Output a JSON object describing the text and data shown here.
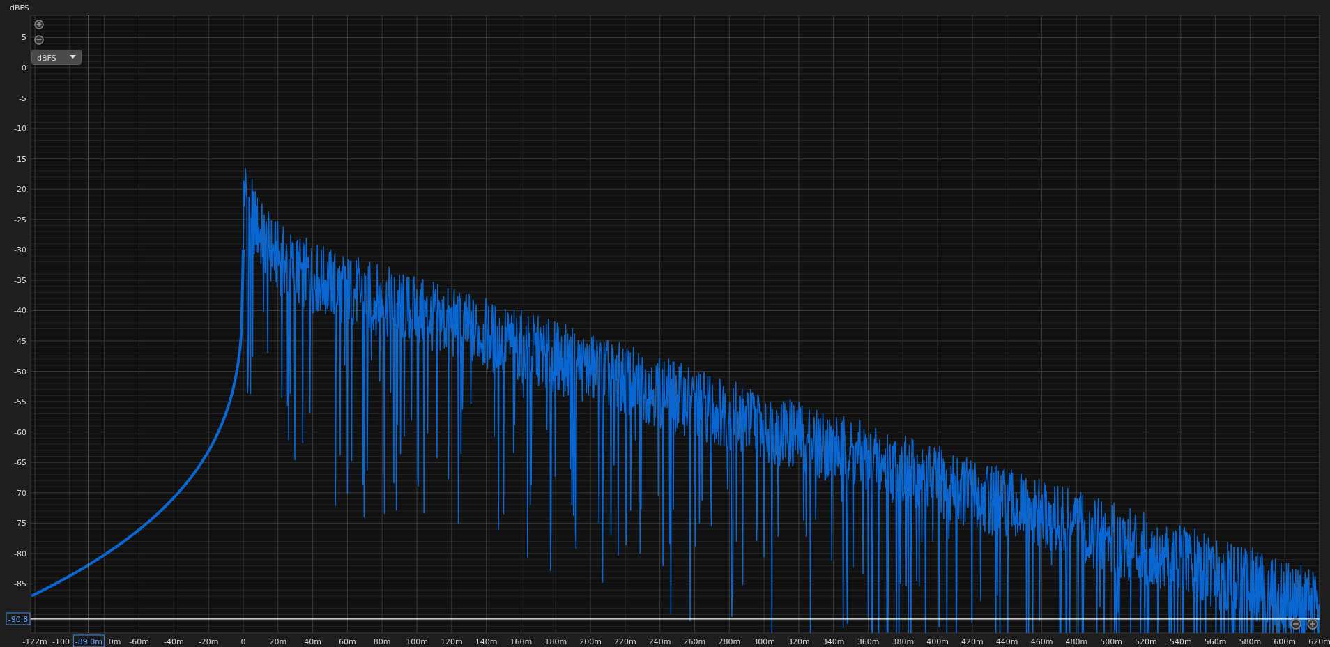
{
  "y_axis": {
    "title": "dBFS",
    "ticks": [
      "5",
      "0",
      "-5",
      "-10",
      "-15",
      "-20",
      "-25",
      "-30",
      "-35",
      "-40",
      "-45",
      "-50",
      "-55",
      "-60",
      "-65",
      "-70",
      "-75",
      "-80",
      "-85"
    ]
  },
  "x_axis": {
    "ticks": [
      "-122m",
      "-100",
      "0m",
      "-60m",
      "-40m",
      "-20m",
      "0",
      "20m",
      "40m",
      "60m",
      "80m",
      "100m",
      "120m",
      "140m",
      "160m",
      "180m",
      "200m",
      "220m",
      "240m",
      "260m",
      "280m",
      "300m",
      "320m",
      "340m",
      "360m",
      "380m",
      "400m",
      "420m",
      "440m",
      "460m",
      "480m",
      "500m",
      "520m",
      "540m",
      "560m",
      "580m",
      "600m",
      "620m"
    ]
  },
  "unit_dropdown": {
    "value": "dBFS"
  },
  "cursor": {
    "y_readout": "-90.8",
    "x_readout": "-89.0m"
  }
}
